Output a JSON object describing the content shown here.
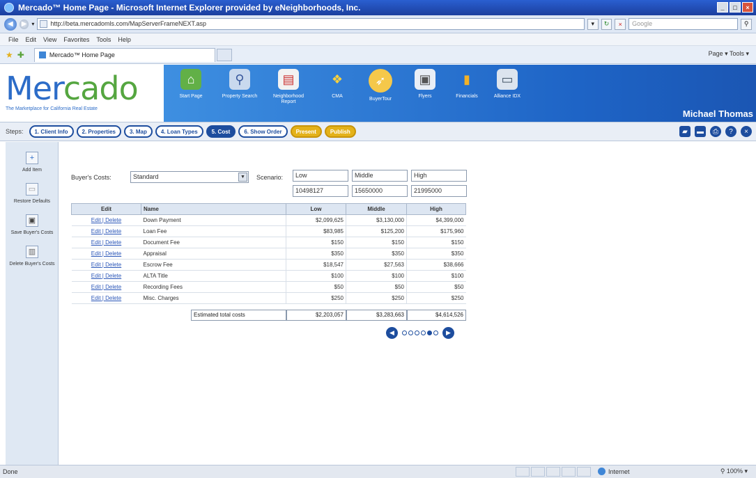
{
  "browser": {
    "title": "Mercado™ Home Page - Microsoft Internet Explorer provided by eNeighborhoods, Inc.",
    "url": "http://beta.mercadomls.com/MapServerFrameNEXT.asp",
    "search_placeholder": "Google",
    "menu": [
      "File",
      "Edit",
      "View",
      "Favorites",
      "Tools",
      "Help"
    ],
    "tab_title": "Mercado™ Home Page",
    "commands": "Page ▾  Tools ▾",
    "status": "Done",
    "zone": "Internet",
    "zoom": "100%"
  },
  "app": {
    "logo_word_a": "Mer",
    "logo_word_b": "cado",
    "logo_tagline": "The Marketplace for California Real Estate",
    "nav": [
      {
        "label": "Start Page",
        "icon": "house-icon"
      },
      {
        "label": "Property Search",
        "icon": "magnifier-icon"
      },
      {
        "label": "Neighborhood Report",
        "icon": "report-icon"
      },
      {
        "label": "CMA",
        "icon": "cma-icon"
      },
      {
        "label": "BuyerTour",
        "icon": "buyer-tour-icon"
      },
      {
        "label": "Flyers",
        "icon": "flyer-icon"
      },
      {
        "label": "Financials",
        "icon": "chart-icon"
      },
      {
        "label": "Alliance IDX",
        "icon": "monitor-icon"
      }
    ],
    "user_name": "Michael Thomas"
  },
  "steps": {
    "label": "Steps:",
    "items": [
      "1. Client Info",
      "2. Properties",
      "3. Map",
      "4. Loan Types",
      "5. Cost",
      "6. Show Order",
      "Present",
      "Publish"
    ]
  },
  "sidebar": {
    "items": [
      {
        "label": "Add Item"
      },
      {
        "label": "Restore Defaults"
      },
      {
        "label": "Save Buyer's Costs"
      },
      {
        "label": "Delete Buyer's Costs"
      }
    ]
  },
  "form": {
    "buyers_costs_label": "Buyer's Costs:",
    "buyers_costs_value": "Standard",
    "scenario_label": "Scenario:",
    "scenario_names": [
      "Low",
      "Middle",
      "High"
    ],
    "scenario_prices": [
      "10498127",
      "15650000",
      "21995000"
    ]
  },
  "table": {
    "headers": [
      "Edit",
      "Name",
      "Low",
      "Middle",
      "High"
    ],
    "edit_link": "Edit",
    "delete_link": "Delete",
    "rows": [
      {
        "name": "Down Payment",
        "low": "$2,099,625",
        "middle": "$3,130,000",
        "high": "$4,399,000"
      },
      {
        "name": "Loan Fee",
        "low": "$83,985",
        "middle": "$125,200",
        "high": "$175,960"
      },
      {
        "name": "Document Fee",
        "low": "$150",
        "middle": "$150",
        "high": "$150"
      },
      {
        "name": "Appraisal",
        "low": "$350",
        "middle": "$350",
        "high": "$350"
      },
      {
        "name": "Escrow Fee",
        "low": "$18,547",
        "middle": "$27,563",
        "high": "$38,666"
      },
      {
        "name": "ALTA Title",
        "low": "$100",
        "middle": "$100",
        "high": "$100"
      },
      {
        "name": "Recording Fees",
        "low": "$50",
        "middle": "$50",
        "high": "$50"
      },
      {
        "name": "Misc. Charges",
        "low": "$250",
        "middle": "$250",
        "high": "$250"
      }
    ],
    "total_label": "Estimated total costs",
    "total_low": "$2,203,057",
    "total_middle": "$3,283,663",
    "total_high": "$4,614,526"
  }
}
